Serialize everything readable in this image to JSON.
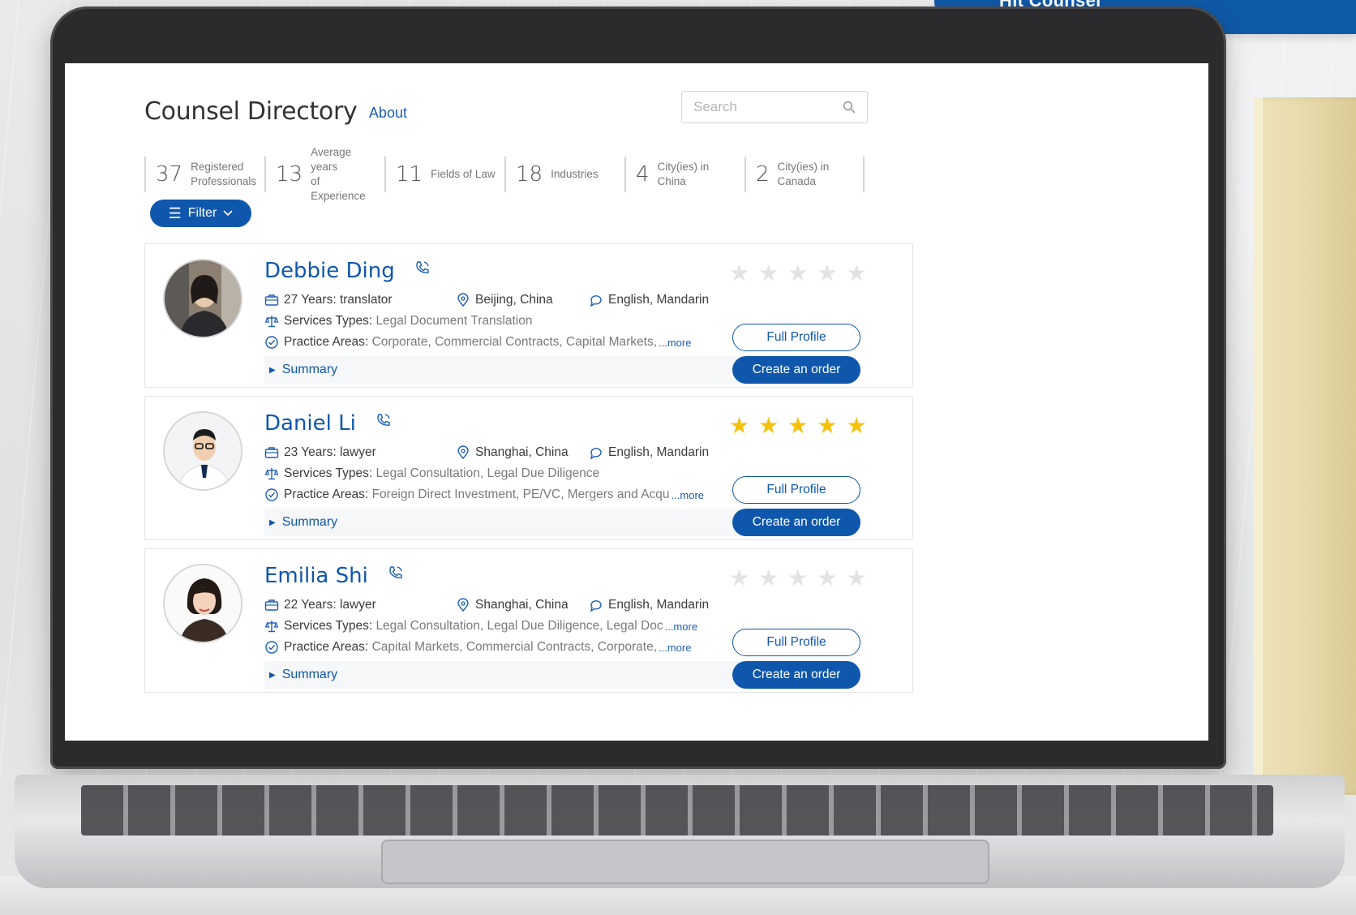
{
  "corner_badge": "Hit Counsel",
  "header": {
    "title": "Counsel Directory",
    "about": "About"
  },
  "search": {
    "placeholder": "Search"
  },
  "stats": [
    {
      "num": "37",
      "label": "Registered\nProfessionals"
    },
    {
      "num": "13",
      "label": "Average years\nof Experience"
    },
    {
      "num": "11",
      "label": "Fields of Law"
    },
    {
      "num": "18",
      "label": "Industries"
    },
    {
      "num": "4",
      "label": "City(ies) in\nChina"
    },
    {
      "num": "2",
      "label": "City(ies) in\nCanada"
    }
  ],
  "filter": {
    "label": "Filter"
  },
  "labels": {
    "services": "Services Types:",
    "practice": "Practice Areas:",
    "more": "...more",
    "summary": "Summary",
    "full_profile": "Full Profile",
    "create_order": "Create an order"
  },
  "counsels": [
    {
      "name": "Debbie Ding",
      "years": "27 Years: translator",
      "location": "Beijing, China",
      "languages": "English, Mandarin",
      "services": "Legal Document Translation",
      "practice": "Corporate, Commercial Contracts, Capital Markets, ",
      "rating": 0
    },
    {
      "name": "Daniel Li",
      "years": "23 Years: lawyer",
      "location": "Shanghai, China",
      "languages": "English, Mandarin",
      "services": "Legal Consultation, Legal Due Diligence",
      "practice": "Foreign Direct Investment, PE/VC, Mergers and Acqu",
      "rating": 5
    },
    {
      "name": "Emilia Shi",
      "years": "22 Years: lawyer",
      "location": "Shanghai, China",
      "languages": "English, Mandarin",
      "services": "Legal Consultation, Legal Due Diligence, Legal Doc",
      "practice": "Capital Markets, Commercial Contracts, Corporate, ",
      "rating": 0
    }
  ],
  "colors": {
    "accent": "#0e57ac",
    "star_on": "#f4c20d",
    "star_off": "#e3e3e3"
  }
}
